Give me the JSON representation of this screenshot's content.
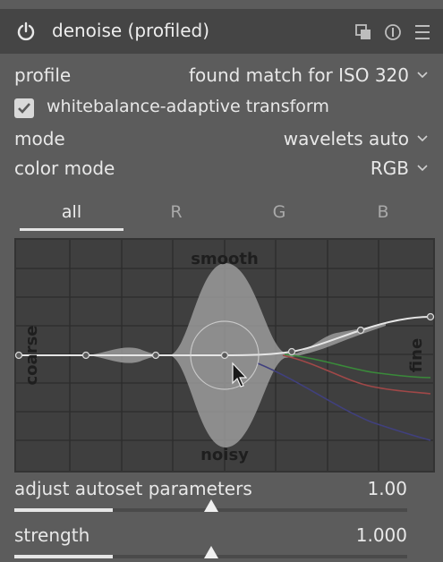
{
  "module": {
    "title": "denoise (profiled)",
    "icons": [
      "power-icon",
      "presets-icon",
      "reset-icon",
      "menu-icon"
    ]
  },
  "profile": {
    "label": "profile",
    "value": "found match for ISO 320"
  },
  "wb_transform": {
    "label": "whitebalance-adaptive transform",
    "checked": true
  },
  "mode": {
    "label": "mode",
    "value": "wavelets auto"
  },
  "color_mode": {
    "label": "color mode",
    "value": "RGB"
  },
  "tabs": [
    {
      "label": "all",
      "active": true
    },
    {
      "label": "R",
      "active": false
    },
    {
      "label": "G",
      "active": false
    },
    {
      "label": "B",
      "active": false
    }
  ],
  "graph": {
    "top_label": "smooth",
    "bottom_label": "noisy",
    "left_label": "coarse",
    "right_label": "fine"
  },
  "adjust": {
    "label": "adjust autoset parameters",
    "value": "1.00",
    "fraction": 0.25
  },
  "strength": {
    "label": "strength",
    "value": "1.000",
    "fraction": 0.25
  },
  "colors": {
    "panel_bg": "#5c5c5c",
    "header_bg": "#454545",
    "graph_bg": "#3f3f3f",
    "curve": "#e6e6e6",
    "red_curve": "#a04848",
    "green_curve": "#3a8a3a",
    "blue_curve": "#40407e"
  }
}
